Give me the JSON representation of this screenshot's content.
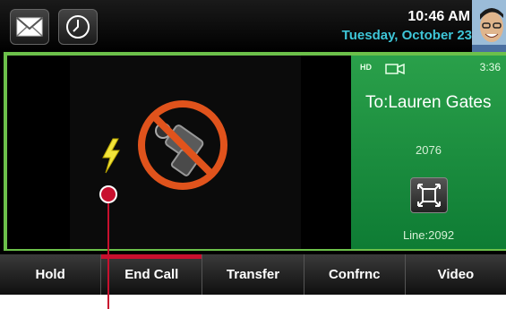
{
  "status_bar": {
    "time": "10:46 AM",
    "date": "Tuesday, October 23",
    "buttons": [
      {
        "icon": "mail-icon"
      },
      {
        "icon": "clock-icon"
      }
    ]
  },
  "call": {
    "indicators": {
      "hd": "HD",
      "video_icon": "video-camera-icon"
    },
    "duration": "3:36",
    "to": "To:Lauren Gates",
    "number": "2076",
    "line": "Line:2092"
  },
  "video": {
    "status_icons": [
      "lightning-icon",
      "camera-disabled-icon"
    ]
  },
  "softkeys": [
    {
      "label": "Hold",
      "active": false
    },
    {
      "label": "End Call",
      "active": true
    },
    {
      "label": "Transfer",
      "active": false
    },
    {
      "label": "Confrnc",
      "active": false
    },
    {
      "label": "Video",
      "active": false
    }
  ],
  "colors": {
    "accent_green": "#6cc04a",
    "date_cyan": "#3ec6d8",
    "end_call_red": "#c8102e"
  }
}
